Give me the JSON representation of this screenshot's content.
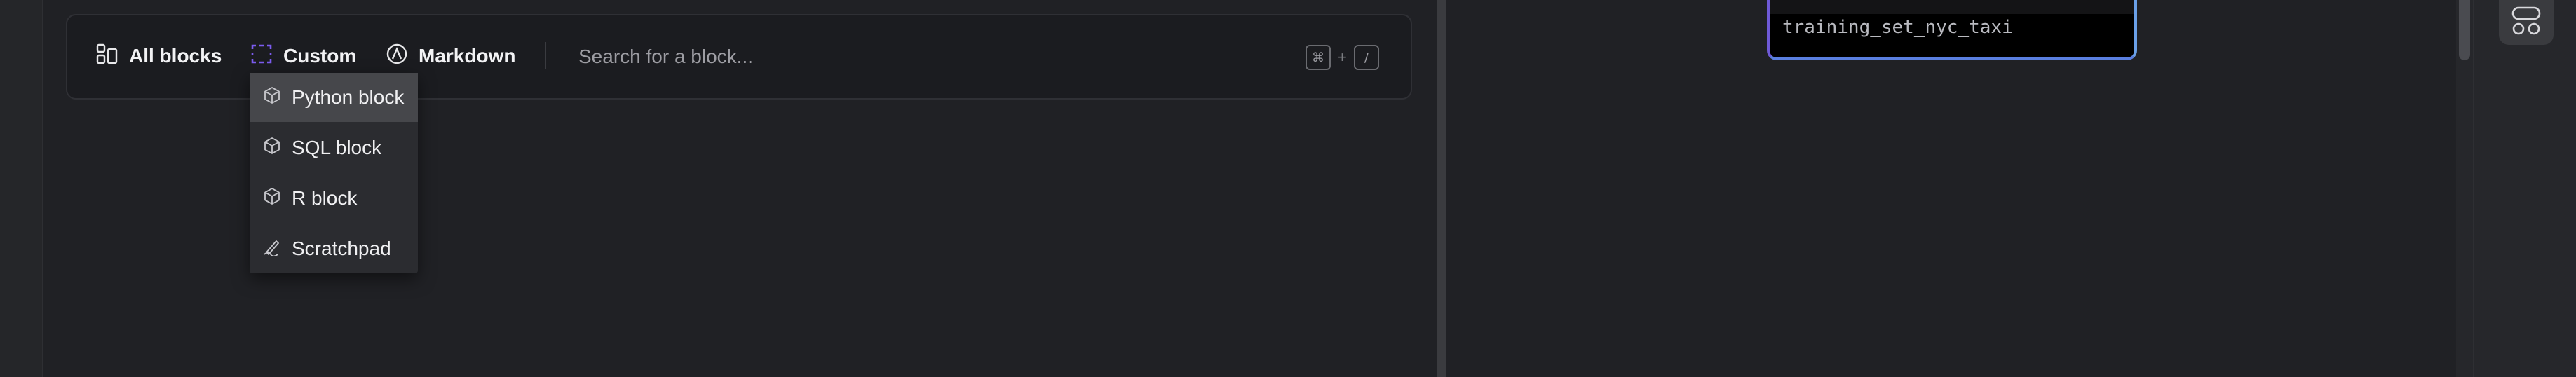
{
  "toolbar": {
    "all_blocks_label": "All blocks",
    "custom_label": "Custom",
    "markdown_label": "Markdown",
    "search_placeholder": "Search for a block...",
    "shortcut_key": "⌘",
    "shortcut_plus": "+",
    "shortcut_slash": "/"
  },
  "dropdown": {
    "items": [
      {
        "label": "Python block",
        "icon": "cube-icon",
        "active": true
      },
      {
        "label": "SQL block",
        "icon": "cube-icon",
        "active": false
      },
      {
        "label": "R block",
        "icon": "cube-icon",
        "active": false
      },
      {
        "label": "Scratchpad",
        "icon": "pen-icon",
        "active": false
      }
    ]
  },
  "graph": {
    "node_label": "training_set_nyc_taxi"
  },
  "colors": {
    "custom_icon": "#7c5cf0",
    "node_border_start": "#6f5ad8",
    "node_border_end": "#6aa0e8"
  }
}
